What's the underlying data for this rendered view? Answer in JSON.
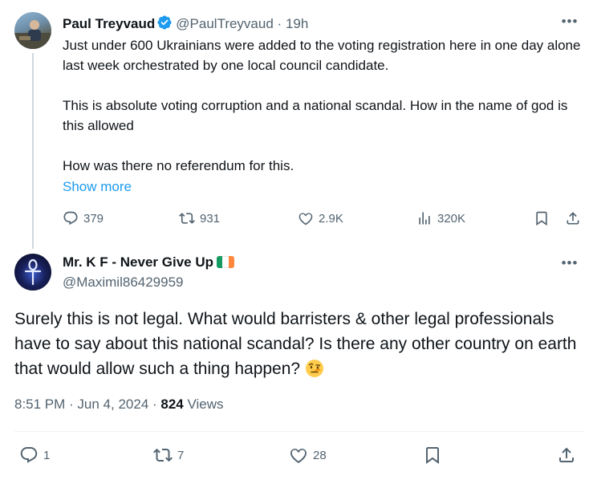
{
  "tweet1": {
    "name": "Paul Treyvaud",
    "handle": "@PaulTreyvaud",
    "separator": "·",
    "time": "19h",
    "more": "•••",
    "body": [
      "Just under 600 Ukrainians were added to the voting registration here in one day alone last week orchestrated by one local council candidate.",
      "This is absolute voting corruption and a national scandal. How in the name of god is this allowed",
      "How was there no referendum for this."
    ],
    "show_more": "Show more",
    "replies": "379",
    "reposts": "931",
    "likes": "2.9K",
    "views": "320K"
  },
  "tweet2": {
    "name": "Mr. K F - Never Give Up",
    "handle": "@Maximil86429959",
    "more": "•••",
    "body": "Surely this is not legal. What would barristers & other legal professionals have to say about this national scandal? Is there any other country on earth that would allow such a thing happen?",
    "timestamp": "8:51 PM · Jun 4, 2024 · ",
    "views_count": "824",
    "views_label": " Views",
    "replies": "1",
    "reposts": "7",
    "likes": "28"
  },
  "colors": {
    "text": "#0f1419",
    "secondary": "#536471",
    "link": "#1d9bf0",
    "verified": "#1d9bf0",
    "thread_line": "#cfd9de",
    "flag_green": "#169b62",
    "flag_white": "#ffffff",
    "flag_orange": "#ff883e"
  },
  "icons": {
    "verified": "verified-badge-icon",
    "reply": "reply-icon",
    "repost": "repost-icon",
    "like": "heart-icon",
    "views": "views-bar-chart-icon",
    "bookmark": "bookmark-icon",
    "share": "share-icon",
    "flag": "ireland-flag-emoji",
    "emoji": "raised-eyebrow-emoji"
  }
}
